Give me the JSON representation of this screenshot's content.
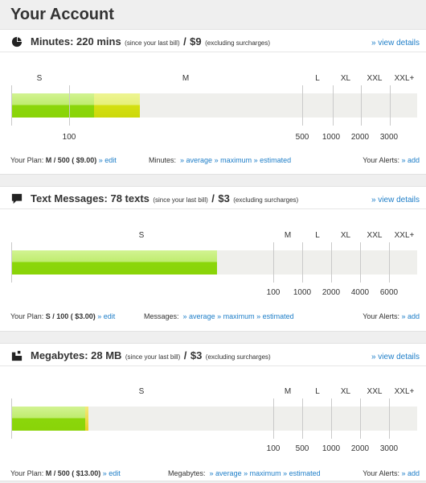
{
  "page": {
    "title": "Your Account"
  },
  "common": {
    "view_details": "» view details",
    "since_last_bill": "(since your last bill)",
    "slash": "/",
    "excluding_surcharges": "(excluding surcharges)",
    "your_plan_label": "Your Plan:",
    "edit_link": "» edit",
    "average_link": "» average",
    "maximum_link": "» maximum",
    "estimated_link": "» estimated",
    "your_alerts_label": "Your Alerts:",
    "add_link": "» add"
  },
  "colors": {
    "link": "#1e7ec8",
    "green": "#8bd60b",
    "yellow": "#d4e012"
  },
  "sections": [
    {
      "icon": "pie-chart-icon",
      "title": "Minutes: 220 mins",
      "price": "$9",
      "tiers": [
        "S",
        "M",
        "L",
        "XL",
        "XXL",
        "XXL+"
      ],
      "ticks": [
        "100",
        "500",
        "1000",
        "2000",
        "3000"
      ],
      "usage_fill_fraction": 0.32,
      "plan_value": "M / 500 ( $9.00)",
      "usage_label": "Minutes:"
    },
    {
      "icon": "speech-bubble-icon",
      "title": "Text Messages: 78 texts",
      "price": "$3",
      "tiers": [
        "S",
        "M",
        "L",
        "XL",
        "XXL",
        "XXL+"
      ],
      "ticks": [
        "100",
        "1000",
        "2000",
        "4000",
        "6000"
      ],
      "usage_fill_fraction": 0.507,
      "plan_value": "S / 100 ( $3.00)",
      "usage_label": "Messages:"
    },
    {
      "icon": "data-blocks-icon",
      "title": "Megabytes: 28 MB",
      "price": "$3",
      "tiers": [
        "S",
        "M",
        "L",
        "XL",
        "XXL",
        "XXL+"
      ],
      "ticks": [
        "100",
        "500",
        "1000",
        "2000",
        "3000"
      ],
      "usage_fill_fraction": 0.19,
      "plan_value": "M / 500 ( $13.00)",
      "usage_label": "Megabytes:"
    }
  ]
}
